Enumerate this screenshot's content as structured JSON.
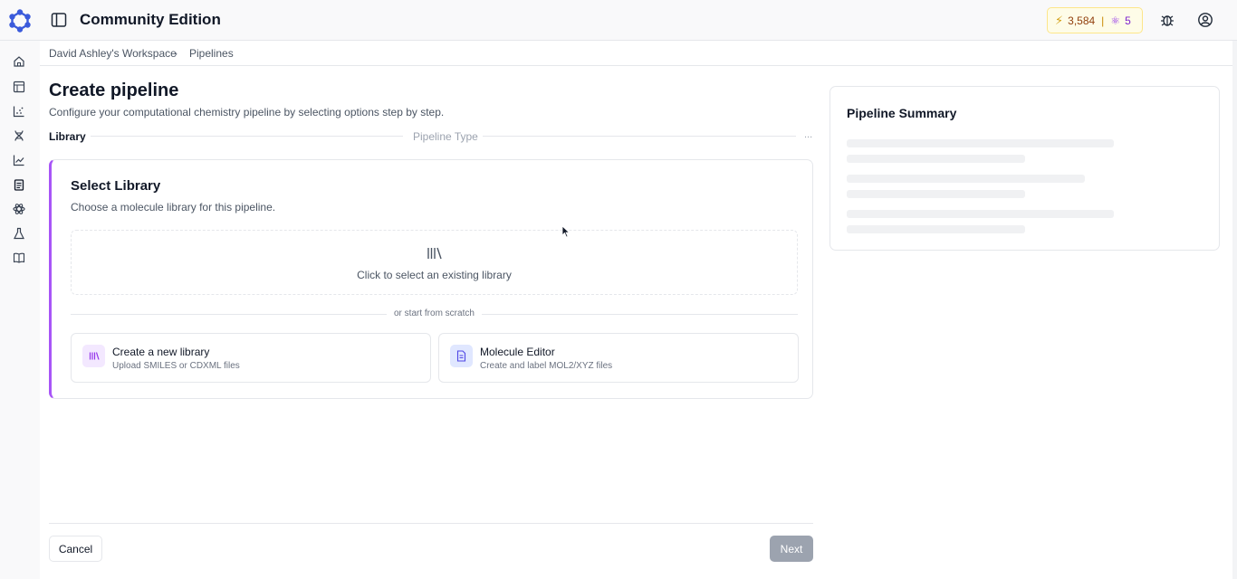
{
  "header": {
    "app_title": "Community Edition",
    "credits": "3,584",
    "credits_separator": "|",
    "atoms": "5"
  },
  "breadcrumb": {
    "workspace": "David Ashley's Workspace",
    "chevron": "›",
    "current": "Pipelines"
  },
  "page": {
    "title": "Create pipeline",
    "subtitle": "Configure your computational chemistry pipeline by selecting options step by step."
  },
  "steps": {
    "step1": "Library",
    "step2": "Pipeline Type",
    "more": "..."
  },
  "card": {
    "title": "Select Library",
    "subtitle": "Choose a molecule library for this pipeline.",
    "dropzone_text": "Click to select an existing library",
    "divider_text": "or start from scratch",
    "options": [
      {
        "title": "Create a new library",
        "subtitle": "Upload SMILES or CDXML files",
        "icon": "library-icon"
      },
      {
        "title": "Molecule Editor",
        "subtitle": "Create and label MOL2/XYZ files",
        "icon": "document-icon"
      }
    ]
  },
  "footer": {
    "cancel_label": "Cancel",
    "next_label": "Next"
  },
  "summary": {
    "title": "Pipeline Summary"
  },
  "colors": {
    "accent": "#a855f7",
    "brand": "#3b5bdb",
    "disabled_button": "#9ca3af"
  }
}
